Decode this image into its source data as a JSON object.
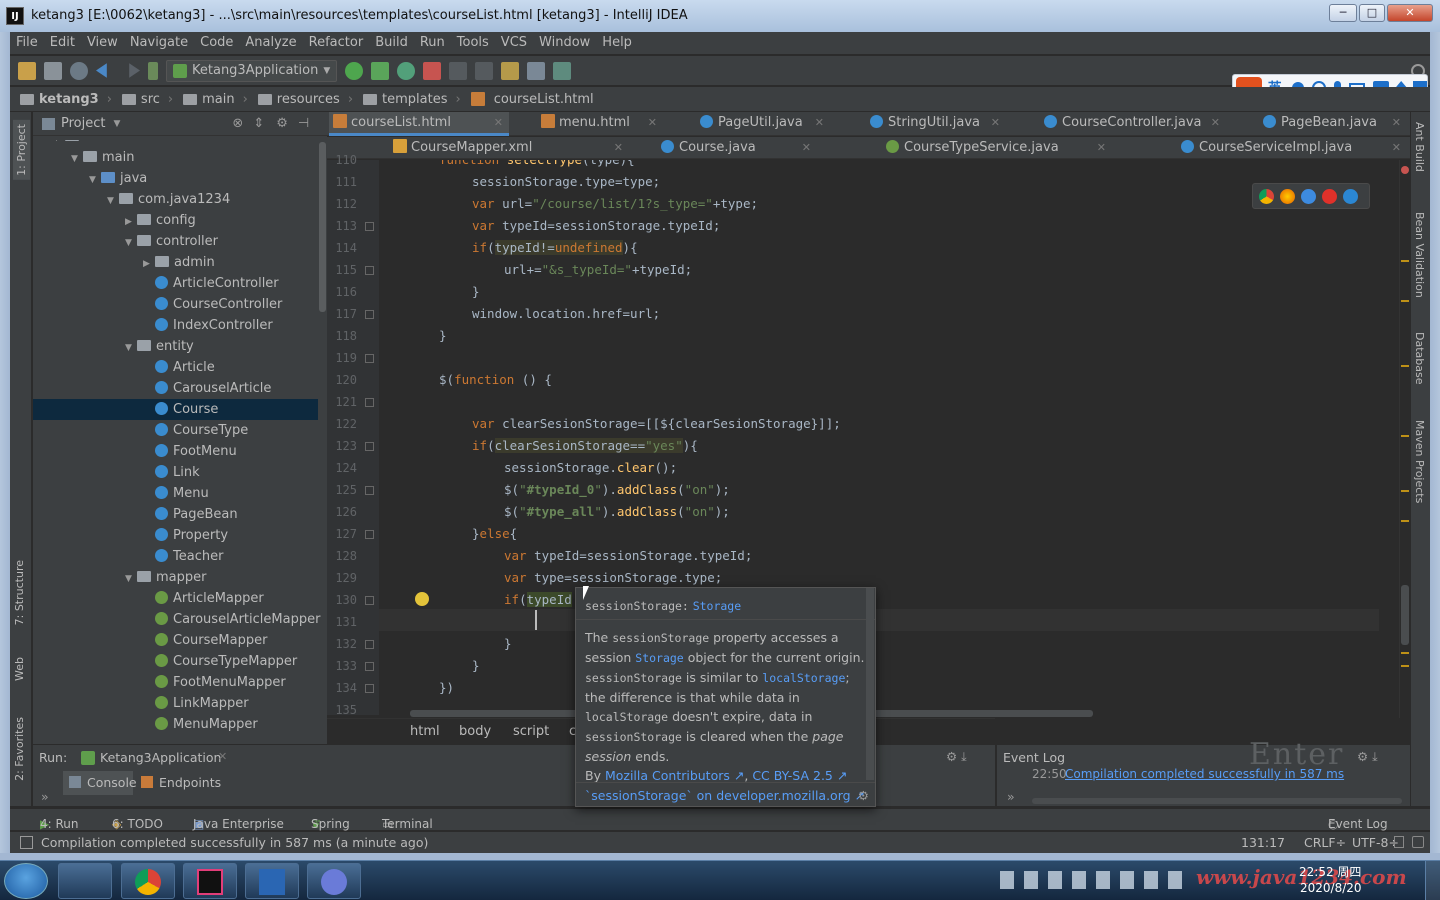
{
  "window": {
    "title": "ketang3 [E:\\0062\\ketang3] - ...\\src\\main\\resources\\templates\\courseList.html [ketang3] - IntelliJ IDEA",
    "app_badge": "IJ",
    "min": "─",
    "max": "□",
    "close": "✕"
  },
  "menu": [
    "File",
    "Edit",
    "View",
    "Navigate",
    "Code",
    "Analyze",
    "Refactor",
    "Build",
    "Run",
    "Tools",
    "VCS",
    "Window",
    "Help"
  ],
  "toolbar": {
    "run_config": "Ketang3Application"
  },
  "nav": {
    "crumbs": [
      "ketang3",
      "src",
      "main",
      "resources",
      "templates",
      "courseList.html"
    ]
  },
  "left_stripe": {
    "project": "1: Project",
    "structure": "7: Structure",
    "web": "Web",
    "favorites": "2: Favorites"
  },
  "project": {
    "title": "Project",
    "tree": [
      {
        "label": "src",
        "arrow": "▼"
      },
      {
        "label": "main",
        "arrow": "▼"
      },
      {
        "label": "java",
        "arrow": "▼"
      },
      {
        "label": "com.java1234",
        "arrow": "▼"
      },
      {
        "label": "config",
        "arrow": "▶"
      },
      {
        "label": "controller",
        "arrow": "▼"
      },
      {
        "label": "admin",
        "arrow": "▶"
      },
      {
        "label": "ArticleController"
      },
      {
        "label": "CourseController"
      },
      {
        "label": "IndexController"
      },
      {
        "label": "entity",
        "arrow": "▼"
      },
      {
        "label": "Article"
      },
      {
        "label": "CarouselArticle"
      },
      {
        "label": "Course"
      },
      {
        "label": "CourseType"
      },
      {
        "label": "FootMenu"
      },
      {
        "label": "Link"
      },
      {
        "label": "Menu"
      },
      {
        "label": "PageBean"
      },
      {
        "label": "Property"
      },
      {
        "label": "Teacher"
      },
      {
        "label": "mapper",
        "arrow": "▼"
      },
      {
        "label": "ArticleMapper"
      },
      {
        "label": "CarouselArticleMapper"
      },
      {
        "label": "CourseMapper"
      },
      {
        "label": "CourseTypeMapper"
      },
      {
        "label": "FootMenuMapper"
      },
      {
        "label": "LinkMapper"
      },
      {
        "label": "MenuMapper"
      }
    ]
  },
  "tabs_row1": [
    "courseList.html",
    "menu.html",
    "PageUtil.java",
    "StringUtil.java",
    "CourseController.java",
    "PageBean.java"
  ],
  "tabs_row2": [
    "CourseMapper.xml",
    "Course.java",
    "CourseTypeService.java",
    "CourseServiceImpl.java"
  ],
  "editor": {
    "line_numbers": [
      "110",
      "111",
      "112",
      "113",
      "114",
      "115",
      "116",
      "117",
      "118",
      "119",
      "120",
      "121",
      "122",
      "123",
      "124",
      "125",
      "126",
      "127",
      "128",
      "129",
      "130",
      "131",
      "132",
      "133",
      "134",
      "135"
    ]
  },
  "breadcrumb": [
    "html",
    "body",
    "script",
    "c"
  ],
  "quickdoc": {
    "signature_name": "sessionStorage:",
    "signature_type": "Storage",
    "p1": "The",
    "t_session": "sessionStorage",
    "p2": "property accesses a session",
    "t_storage": "Storage",
    "p3": "object for the current origin.",
    "t_session2": "sessionStorage",
    "p4": "is similar to",
    "t_local": "localStorage",
    "p5": "; the difference is that while data in",
    "t_local2": "localStorage",
    "p6": "doesn't expire, data in",
    "t_session3": "sessionStorage",
    "p7": "is cleared when the",
    "p8": "page session",
    "p9": "ends.",
    "by": "By",
    "contrib": "Mozilla Contributors ↗",
    "comma": ",",
    "license": "CC BY-SA 2.5 ↗",
    "footer": "`sessionStorage` on developer.mozilla.org ↗"
  },
  "right_stripe": [
    "Ant Build",
    "Bean Validation",
    "Database",
    "Maven Projects"
  ],
  "run_panel": {
    "label": "Run:",
    "config": "Ketang3Application",
    "console": "Console",
    "endpoints": "Endpoints"
  },
  "event_log": {
    "title": "Event Log",
    "time": "22:50",
    "message": "Compilation completed successfully in 587 ms",
    "watermark": "Enter"
  },
  "bottom_tabs": {
    "run": "4: Run",
    "todo": "6: TODO",
    "java_ent": "Java Enterprise",
    "spring": "Spring",
    "terminal": "Terminal",
    "event_log": "Event Log"
  },
  "status": {
    "message": "Compilation completed successfully in 587 ms (a minute ago)",
    "position": "131:17",
    "line_sep": "CRLF÷",
    "encoding": "UTF-8÷"
  },
  "ime": {
    "label": "英"
  },
  "taskbar": {
    "time": "22:52 周四",
    "date": "2020/8/20",
    "watermark": "www.java1234.com"
  }
}
